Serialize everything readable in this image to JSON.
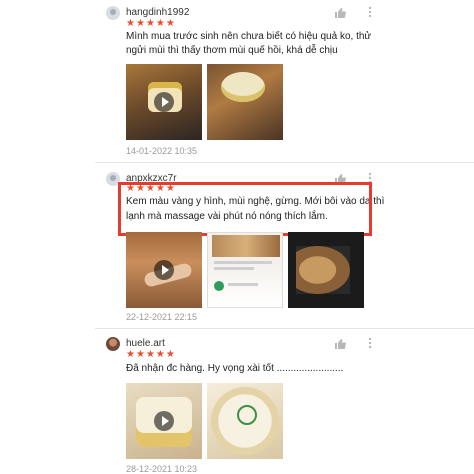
{
  "reviews": [
    {
      "username": "hangdinh1992",
      "stars": "★★★★★",
      "text_lines": [
        "Mình mua trước sinh nên chưa biết có hiệu quả ko,  thử",
        "ngửi mùi thì thấy thơm mùi quế hồi, khá dễ chịu"
      ],
      "date": "14-01-2022 10:35"
    },
    {
      "username": "anpxkzxc7r",
      "stars": "★★★★★",
      "text_lines": [
        "Kem màu vàng y hình, mùi nghệ, gừng. Mới bôi vào da thì",
        "lạnh mà massage vài phút nó nóng thích lắm."
      ],
      "date": "22-12-2021 22:15"
    },
    {
      "username": "huele.art",
      "stars": "★★★★★",
      "text_lines": [
        "Đã nhận đc hàng. Hy vọng xài tốt ........................"
      ],
      "date": "28-12-2021 10:23"
    }
  ],
  "icons": {
    "like": "thumbs-up-icon",
    "more": "more-vertical-icon",
    "play": "play-icon"
  },
  "colors": {
    "star": "#ee4d2d",
    "highlight": "#e63b2e"
  }
}
